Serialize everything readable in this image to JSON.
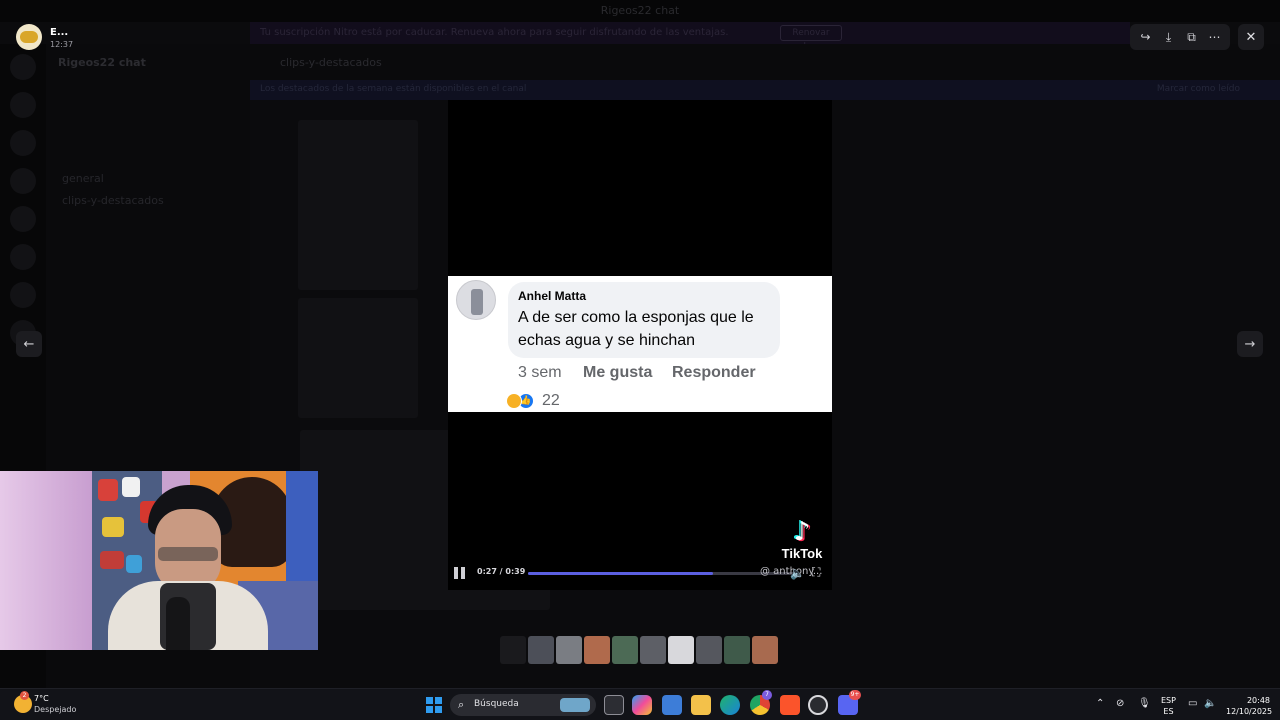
{
  "viewer": {
    "user_name": "E...",
    "user_time": "12:37",
    "toolbar": {
      "share_icon": "share-icon",
      "download_icon": "download-icon",
      "open_icon": "open-external-icon",
      "more_icon": "more-icon"
    },
    "close_icon": "close-icon",
    "prev_icon": "arrow-left-icon",
    "next_icon": "arrow-right-icon"
  },
  "background_app": {
    "window_title": "Rigeos22 chat",
    "banner_text": "Tu suscripción Nitro está por caducar. Renueva ahora para seguir disfrutando de las ventajas.",
    "banner_button": "Renovar ahora",
    "server_name": "Rigeos22 chat",
    "channel_title": "clips-y-destacados",
    "strip_text": "Los destacados de la semana están disponibles en el canal",
    "strip_right": "Marcar como leído",
    "channels": [
      "general",
      "clips-y-destacados"
    ]
  },
  "comment": {
    "author": "Anhel Matta",
    "text": "A de ser como la esponjas que le echas agua y se hinchan",
    "age": "3 sem",
    "like_label": "Me gusta",
    "reply_label": "Responder",
    "reaction_count": "22",
    "reactions": [
      "haha",
      "like"
    ]
  },
  "video": {
    "brand": "TikTok",
    "time": "0:27 / 0:39",
    "progress": 0.69,
    "handle": "@ anthony...",
    "colors": {
      "progress": "#5b5fe0",
      "tiktok_cyan": "#25f4ee",
      "tiktok_red": "#fe2c55"
    }
  },
  "taskbar": {
    "weather_temp": "7°C",
    "weather_desc": "Despejado",
    "weather_badge": "2",
    "search_label": "Búsqueda",
    "lang_top": "ESP",
    "lang_bottom": "ES",
    "time": "20:48",
    "date": "12/10/2025",
    "discord_badge": "9+",
    "chrome_badge": "7"
  }
}
